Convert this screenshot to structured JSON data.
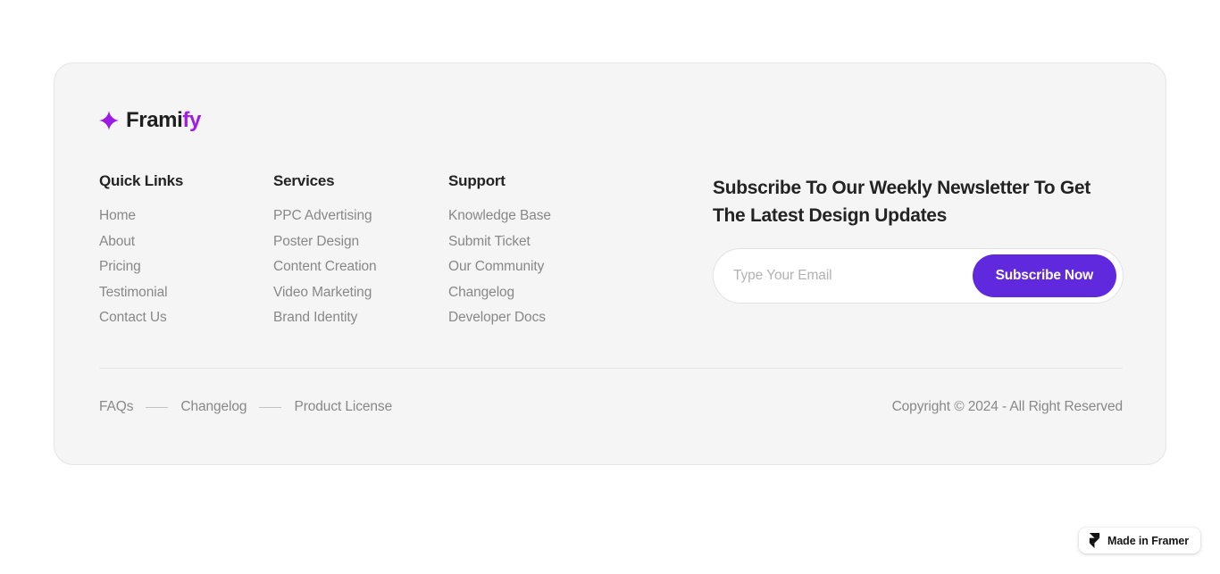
{
  "brand": {
    "icon": "sparkle-icon",
    "name_primary": "Frami",
    "name_accent": "fy",
    "accent_color": "#a21ae6"
  },
  "columns": [
    {
      "title": "Quick Links",
      "links": [
        "Home",
        "About",
        "Pricing",
        "Testimonial",
        "Contact Us"
      ]
    },
    {
      "title": "Services",
      "links": [
        "PPC Advertising",
        "Poster Design",
        "Content Creation",
        "Video Marketing",
        "Brand Identity"
      ]
    },
    {
      "title": "Support",
      "links": [
        "Knowledge Base",
        "Submit Ticket",
        "Our Community",
        "Changelog",
        "Developer Docs"
      ]
    }
  ],
  "newsletter": {
    "title": "Subscribe To Our Weekly Newsletter To Get The Latest Design Updates",
    "email_placeholder": "Type Your Email",
    "email_value": "",
    "button_label": "Subscribe Now",
    "button_color": "#6129dd"
  },
  "bottom": {
    "links": [
      "FAQs",
      "Changelog",
      "Product License"
    ],
    "separator": "dash",
    "copyright": "Copyright © 2024 - All Right Reserved"
  },
  "badge": {
    "icon": "framer-logo-icon",
    "label": "Made in Framer"
  }
}
